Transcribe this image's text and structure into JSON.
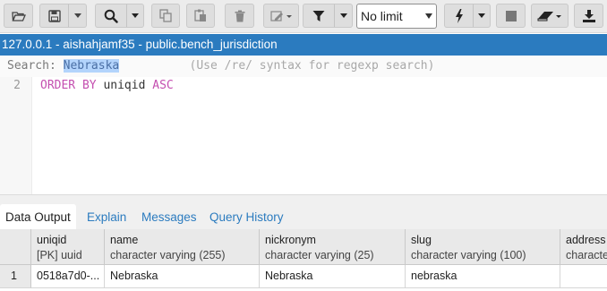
{
  "toolbar": {
    "buttons": [
      {
        "name": "open-file",
        "icon": "folder-open-icon"
      },
      {
        "name": "save-file",
        "icon": "floppy-disk-icon"
      },
      {
        "name": "save-dropdown",
        "icon": "caret-down-icon"
      },
      {
        "name": "find",
        "icon": "search-icon"
      },
      {
        "name": "find-dropdown",
        "icon": "caret-down-icon"
      },
      {
        "name": "copy",
        "icon": "copy-icon"
      },
      {
        "name": "paste",
        "icon": "paste-icon"
      },
      {
        "name": "delete",
        "icon": "trash-icon"
      },
      {
        "name": "edit",
        "icon": "pencil-icon"
      },
      {
        "name": "filter",
        "icon": "filter-icon"
      },
      {
        "name": "filter-dropdown",
        "icon": "caret-down-icon"
      },
      {
        "name": "execute",
        "icon": "lightning-bolt-icon"
      },
      {
        "name": "execute-dropdown",
        "icon": "caret-down-icon"
      },
      {
        "name": "stop",
        "icon": "stop-square-icon"
      },
      {
        "name": "clear",
        "icon": "eraser-icon"
      },
      {
        "name": "download",
        "icon": "download-icon"
      }
    ],
    "limit": {
      "value": "No limit"
    }
  },
  "title": "127.0.0.1 - aishahjamf35 - public.bench_jurisdiction",
  "search": {
    "label": "Search: ",
    "term": "Nebraska",
    "hint": "(Use /re/ syntax for regexp search)"
  },
  "editor": {
    "line_number": "2",
    "kw1": "ORDER BY",
    "ident": " uniqid ",
    "kw2": "ASC"
  },
  "tabs": [
    "Data Output",
    "Explain",
    "Messages",
    "Query History"
  ],
  "grid": {
    "columns": [
      {
        "name": "uniqid",
        "type": "[PK] uuid"
      },
      {
        "name": "name",
        "type": "character varying (255)"
      },
      {
        "name": "nickronym",
        "type": "character varying (25)"
      },
      {
        "name": "slug",
        "type": "character varying (100)"
      },
      {
        "name": "address",
        "type": "characte"
      }
    ],
    "rows": [
      {
        "num": "1",
        "cells": [
          "0518a7d0-...",
          "Nebraska",
          "Nebraska",
          "nebraska",
          ""
        ]
      }
    ]
  },
  "colors": {
    "title_bar": "#2b7bbf",
    "keyword": "#c44fb0",
    "tab_link": "#2b7bbf",
    "search_highlight": "#b3d4fc"
  }
}
